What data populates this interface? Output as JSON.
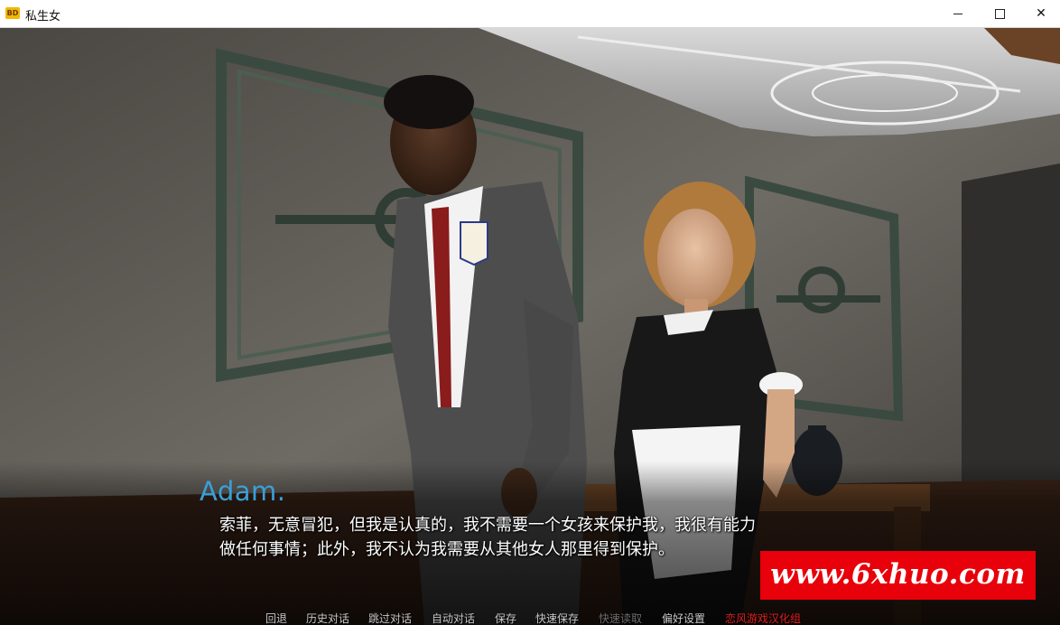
{
  "window": {
    "app_icon_text": "BD",
    "title": "私生女",
    "controls": {
      "minimize": "minimize-icon",
      "maximize": "maximize-icon",
      "close": "close-icon"
    }
  },
  "dialogue": {
    "speaker": "Adam.",
    "line1": "索菲，无意冒犯，但我是认真的，我不需要一个女孩来保护我，我很有能力",
    "line2": "做任何事情；此外，我不认为我需要从其他女人那里得到保护。"
  },
  "quick_menu": {
    "back": "回退",
    "history": "历史对话",
    "skip": "跳过对话",
    "auto": "自动对话",
    "save": "保存",
    "quick_save": "快速保存",
    "quick_load": "快速读取",
    "preferences": "偏好设置",
    "credit": "恋风游戏汉化组"
  },
  "watermark": "www.6xhuo.com",
  "colors": {
    "speaker_name": "#3aa0d8",
    "watermark_bg": "#e8000a",
    "credit_text": "#e02020"
  }
}
